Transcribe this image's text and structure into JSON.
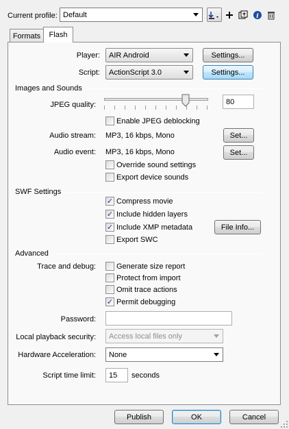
{
  "profile": {
    "label": "Current profile:",
    "value": "Default"
  },
  "toolbar": {
    "import_export_icon": "import-export-icon",
    "add_icon": "plus-icon",
    "duplicate_icon": "duplicate-icon",
    "info_icon": "info-icon",
    "delete_icon": "trash-icon"
  },
  "tabs": [
    "Formats",
    "Flash"
  ],
  "player": {
    "label": "Player:",
    "value": "AIR Android",
    "button": "Settings..."
  },
  "script": {
    "label": "Script:",
    "value": "ActionScript 3.0",
    "button": "Settings..."
  },
  "images_sounds": {
    "heading": "Images and Sounds",
    "jpeg_label": "JPEG quality:",
    "jpeg_value": "80",
    "jpeg_slider_fraction": 0.8,
    "deblocking": {
      "label": "Enable JPEG deblocking",
      "checked": false
    },
    "audio_stream_label": "Audio stream:",
    "audio_stream_value": "MP3, 16 kbps, Mono",
    "audio_event_label": "Audio event:",
    "audio_event_value": "MP3, 16 kbps, Mono",
    "set_label": "Set...",
    "override": {
      "label": "Override sound settings",
      "checked": false
    },
    "export_device": {
      "label": "Export device sounds",
      "checked": false
    }
  },
  "swf": {
    "heading": "SWF Settings",
    "compress": {
      "label": "Compress movie",
      "checked": true
    },
    "hidden_layers": {
      "label": "Include hidden layers",
      "checked": true
    },
    "xmp": {
      "label": "Include XMP metadata",
      "checked": true
    },
    "file_info_button": "File Info...",
    "export_swc": {
      "label": "Export SWC",
      "checked": false
    }
  },
  "advanced": {
    "heading": "Advanced",
    "trace_label": "Trace and debug:",
    "size_report": {
      "label": "Generate size report",
      "checked": false
    },
    "protect": {
      "label": "Protect from import",
      "checked": false
    },
    "omit_trace": {
      "label": "Omit trace actions",
      "checked": false
    },
    "permit_debug": {
      "label": "Permit debugging",
      "checked": true
    },
    "password_label": "Password:",
    "password_value": "",
    "local_playback_label": "Local playback security:",
    "local_playback_value": "Access local files only",
    "hw_accel_label": "Hardware Acceleration:",
    "hw_accel_value": "None",
    "time_limit_label": "Script time limit:",
    "time_limit_value": "15",
    "time_limit_unit": "seconds"
  },
  "footer": {
    "publish": "Publish",
    "ok": "OK",
    "cancel": "Cancel"
  },
  "check_glyph": "✓"
}
